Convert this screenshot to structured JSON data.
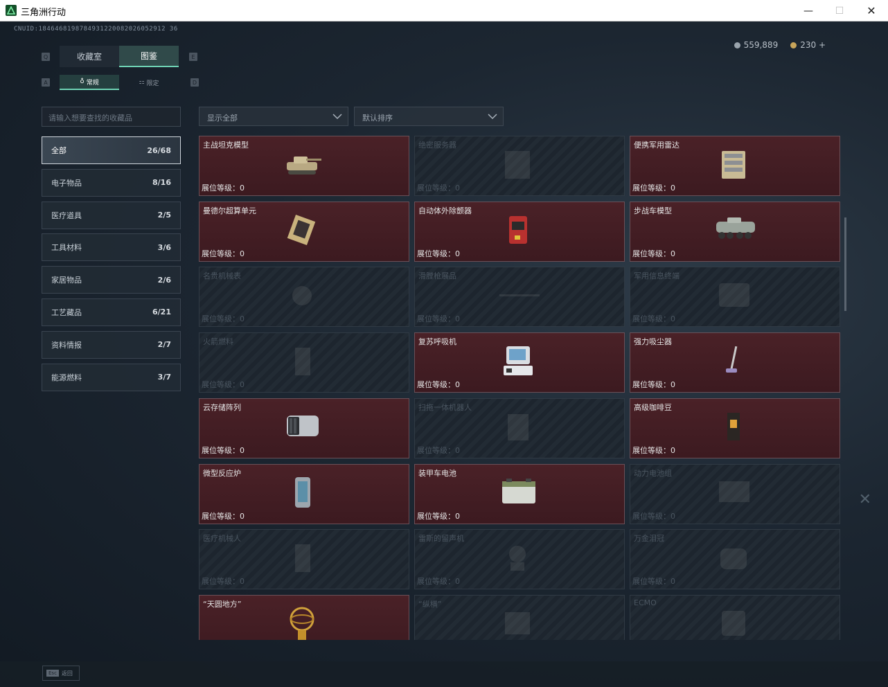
{
  "window": {
    "title": "三角洲行动"
  },
  "header": {
    "uid": "CNUID:1846468198784931220082026052912 36"
  },
  "currency": {
    "silver": "559,889",
    "gold": "230",
    "plus": "+"
  },
  "tabs": [
    {
      "label": "收藏室",
      "active": false
    },
    {
      "label": "图鉴",
      "active": true
    }
  ],
  "subtabs": [
    {
      "label": "常规",
      "active": true
    },
    {
      "label": "限定",
      "active": false
    }
  ],
  "search": {
    "placeholder": "请输入想要查找的收藏品"
  },
  "categories": [
    {
      "label": "全部",
      "count": "26/68",
      "active": true
    },
    {
      "label": "电子物品",
      "count": "8/16",
      "active": false
    },
    {
      "label": "医疗道具",
      "count": "2/5",
      "active": false
    },
    {
      "label": "工具材料",
      "count": "3/6",
      "active": false
    },
    {
      "label": "家居物品",
      "count": "2/6",
      "active": false
    },
    {
      "label": "工艺藏品",
      "count": "6/21",
      "active": false
    },
    {
      "label": "资料情报",
      "count": "2/7",
      "active": false
    },
    {
      "label": "能源燃料",
      "count": "3/7",
      "active": false
    }
  ],
  "filters": {
    "show": "显示全部",
    "sort": "默认排序"
  },
  "level_label": "展位等级：",
  "items": [
    {
      "name": "主战坦克模型",
      "level": "0",
      "owned": true,
      "icon": "tank-icon"
    },
    {
      "name": "绝密服务器",
      "level": "0",
      "owned": false,
      "icon": "server-icon"
    },
    {
      "name": "便携军用雷达",
      "level": "0",
      "owned": true,
      "icon": "radar-icon"
    },
    {
      "name": "曼德尔超算单元",
      "level": "0",
      "owned": true,
      "icon": "cpu-icon"
    },
    {
      "name": "自动体外除颤器",
      "level": "0",
      "owned": true,
      "icon": "defibrillator-icon"
    },
    {
      "name": "步战车模型",
      "level": "0",
      "owned": true,
      "icon": "ifv-icon"
    },
    {
      "name": "名贵机械表",
      "level": "0",
      "owned": false,
      "icon": "watch-icon"
    },
    {
      "name": "滑膛枪展品",
      "level": "0",
      "owned": false,
      "icon": "musket-icon"
    },
    {
      "name": "军用信息终端",
      "level": "0",
      "owned": false,
      "icon": "terminal-icon"
    },
    {
      "name": "火箭燃料",
      "level": "0",
      "owned": false,
      "icon": "fuel-icon"
    },
    {
      "name": "复苏呼吸机",
      "level": "0",
      "owned": true,
      "icon": "ventilator-icon"
    },
    {
      "name": "强力吸尘器",
      "level": "0",
      "owned": true,
      "icon": "vacuum-icon"
    },
    {
      "name": "云存储阵列",
      "level": "0",
      "owned": true,
      "icon": "storage-icon"
    },
    {
      "name": "扫拖一体机器人",
      "level": "0",
      "owned": false,
      "icon": "robot-icon"
    },
    {
      "name": "高级咖啡豆",
      "level": "0",
      "owned": true,
      "icon": "coffee-icon"
    },
    {
      "name": "微型反应炉",
      "level": "0",
      "owned": true,
      "icon": "reactor-icon"
    },
    {
      "name": "装甲车电池",
      "level": "0",
      "owned": true,
      "icon": "battery-icon"
    },
    {
      "name": "动力电池组",
      "level": "0",
      "owned": false,
      "icon": "battery-pack-icon"
    },
    {
      "name": "医疗机械人",
      "level": "0",
      "owned": false,
      "icon": "medical-robot-icon"
    },
    {
      "name": "雷斯的留声机",
      "level": "0",
      "owned": false,
      "icon": "gramophone-icon"
    },
    {
      "name": "万金泪冠",
      "level": "0",
      "owned": false,
      "icon": "crown-icon"
    },
    {
      "name": "“天圆地方”",
      "level": "0",
      "owned": true,
      "icon": "armillary-icon"
    },
    {
      "name": "“纵横”",
      "level": "0",
      "owned": false,
      "icon": "chessboard-icon"
    },
    {
      "name": "ECMO",
      "level": "0",
      "owned": false,
      "icon": "ecmo-icon"
    }
  ],
  "footer": {
    "esc_key": "Esc",
    "esc_label": "返回"
  },
  "kbd_hints": {
    "prev_tab": "Q",
    "next_tab": "E",
    "prev_sub": "A",
    "next_sub": "D"
  }
}
